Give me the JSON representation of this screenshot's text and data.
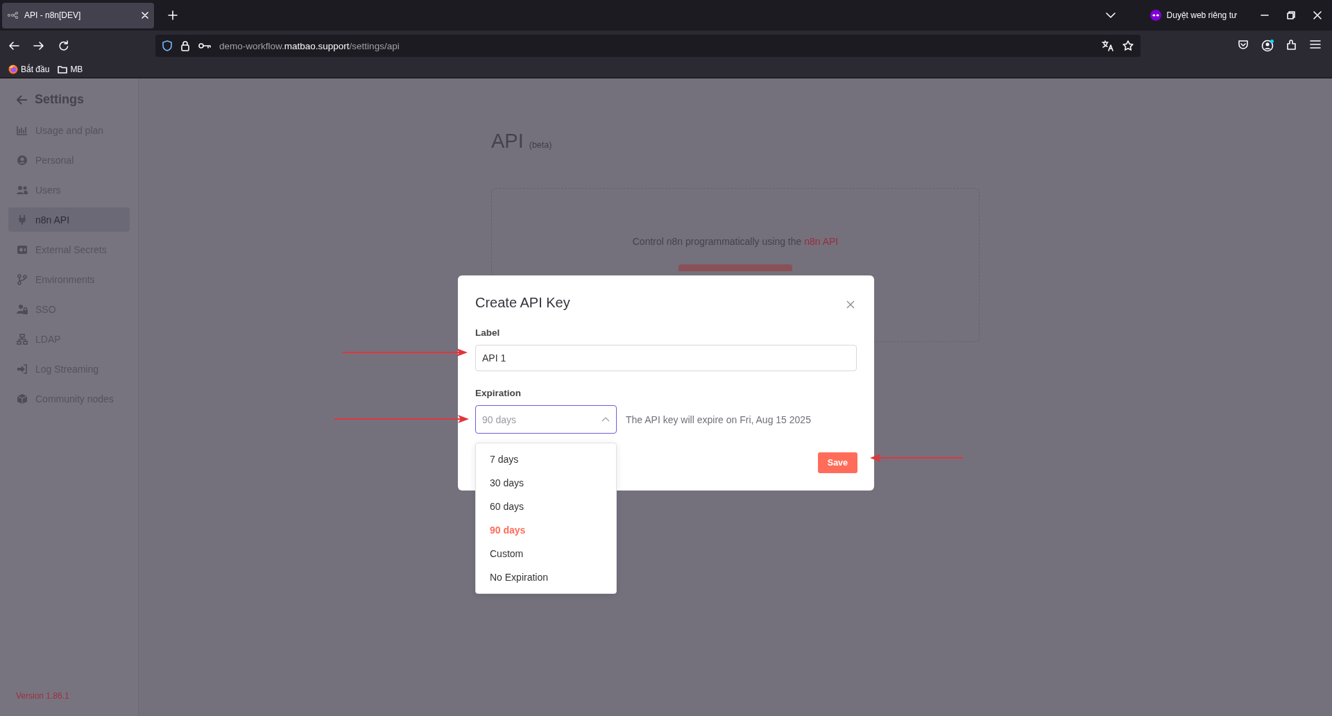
{
  "browser": {
    "tab": {
      "title": "API - n8n[DEV]"
    },
    "private_label": "Duyệt web riêng tư",
    "url": {
      "prefix": "demo-workflow.",
      "host": "matbao.support",
      "path": "/settings/api"
    },
    "bookmarks": [
      {
        "label": "Bắt đầu"
      },
      {
        "label": "MB"
      }
    ]
  },
  "sidebar": {
    "title": "Settings",
    "items": [
      {
        "label": "Usage and plan",
        "selected": false
      },
      {
        "label": "Personal",
        "selected": false
      },
      {
        "label": "Users",
        "selected": false
      },
      {
        "label": "n8n API",
        "selected": true
      },
      {
        "label": "External Secrets",
        "selected": false
      },
      {
        "label": "Environments",
        "selected": false
      },
      {
        "label": "SSO",
        "selected": false
      },
      {
        "label": "LDAP",
        "selected": false
      },
      {
        "label": "Log Streaming",
        "selected": false
      },
      {
        "label": "Community nodes",
        "selected": false
      }
    ],
    "version": "Version 1.86.1"
  },
  "page": {
    "title": "API",
    "badge": "(beta)",
    "description": "Control n8n programmatically using the ",
    "link": "n8n API"
  },
  "dialog": {
    "title": "Create API Key",
    "label_field": {
      "label": "Label",
      "value": "API 1"
    },
    "expiration": {
      "label": "Expiration",
      "placeholder": "90 days",
      "expanded": true,
      "hint": "The API key will expire on Fri, Aug 15 2025",
      "options": [
        {
          "label": "7 days",
          "selected": false
        },
        {
          "label": "30 days",
          "selected": false
        },
        {
          "label": "60 days",
          "selected": false
        },
        {
          "label": "90 days",
          "selected": true
        },
        {
          "label": "Custom",
          "selected": false
        },
        {
          "label": "No Expiration",
          "selected": false
        }
      ]
    },
    "save_button": "Save"
  }
}
